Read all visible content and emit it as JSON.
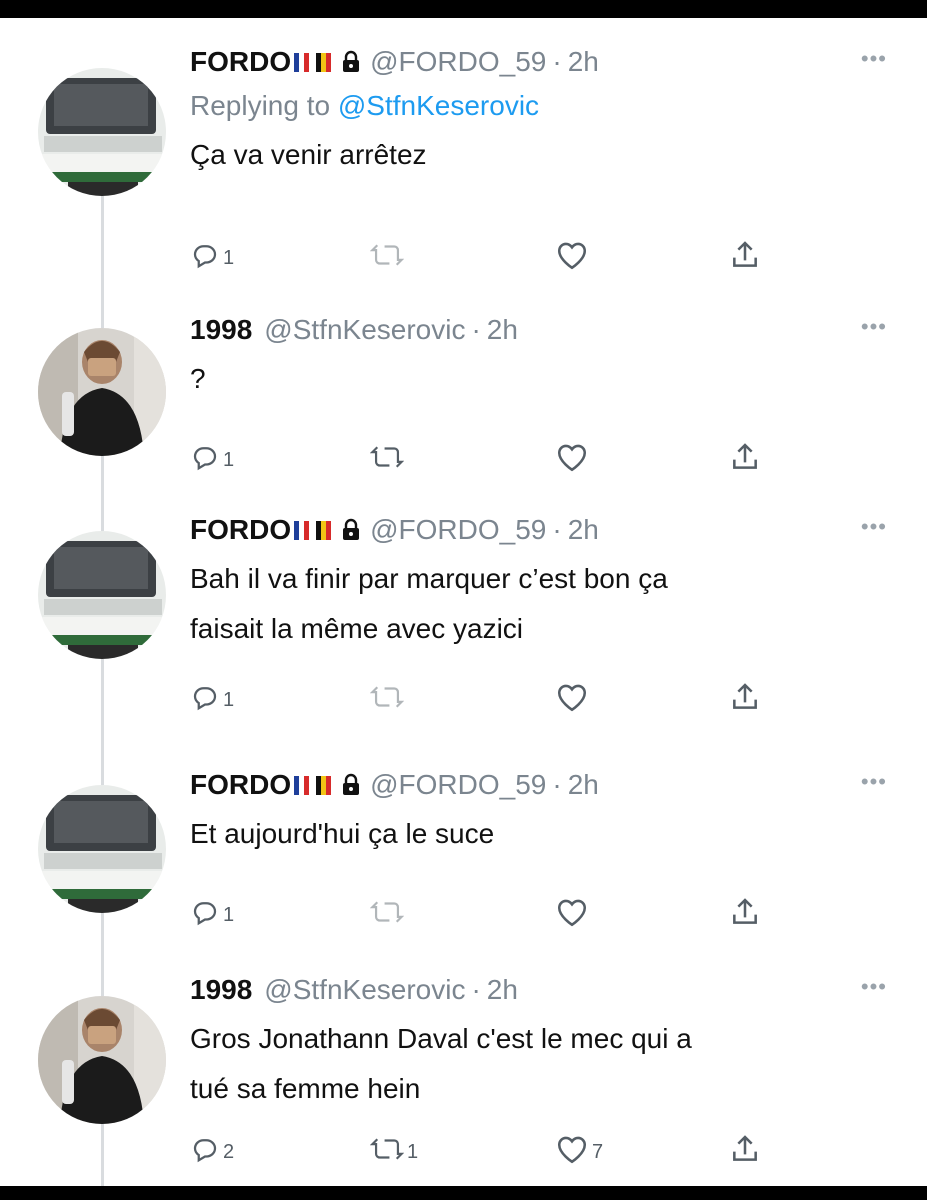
{
  "colors": {
    "link": "#1d9bf0",
    "muted": "#7b858f",
    "text": "#111111",
    "thread_line": "#d9dcdf"
  },
  "tweets": [
    {
      "avatar_icon": "monitor-photo-avatar",
      "name": "FORDO",
      "flags": [
        "flag-france-icon",
        "flag-belgium-icon"
      ],
      "locked": true,
      "handle": "@FORDO_59",
      "separator": "·",
      "time": "2h",
      "replying_label": "Replying to ",
      "replying_mention": "@StfnKeserovic",
      "text": [
        "Ça va venir arrêtez"
      ],
      "replies": "1",
      "retweets": "",
      "likes": "",
      "retweet_enabled": false
    },
    {
      "avatar_icon": "person-photo-avatar",
      "name": "1998",
      "flags": [],
      "locked": false,
      "handle": "@StfnKeserovic",
      "separator": "·",
      "time": "2h",
      "text": [
        "?"
      ],
      "replies": "1",
      "retweets": "",
      "likes": "",
      "retweet_enabled": true
    },
    {
      "avatar_icon": "monitor-photo-avatar",
      "name": "FORDO",
      "flags": [
        "flag-france-icon",
        "flag-belgium-icon"
      ],
      "locked": true,
      "handle": "@FORDO_59",
      "separator": "·",
      "time": "2h",
      "text": [
        "Bah il va finir par marquer c’est bon ça",
        "faisait la même avec yazici"
      ],
      "replies": "1",
      "retweets": "",
      "likes": "",
      "retweet_enabled": false
    },
    {
      "avatar_icon": "monitor-photo-avatar",
      "name": "FORDO",
      "flags": [
        "flag-france-icon",
        "flag-belgium-icon"
      ],
      "locked": true,
      "handle": "@FORDO_59",
      "separator": "·",
      "time": "2h",
      "text": [
        "Et aujourd'hui ça le suce"
      ],
      "replies": "1",
      "retweets": "",
      "likes": "",
      "retweet_enabled": false
    },
    {
      "avatar_icon": "person-photo-avatar",
      "name": "1998",
      "flags": [],
      "locked": false,
      "handle": "@StfnKeserovic",
      "separator": "·",
      "time": "2h",
      "text": [
        "Gros Jonathann Daval c'est le mec qui a",
        "tué sa femme hein"
      ],
      "replies": "2",
      "retweets": "1",
      "likes": "7",
      "retweet_enabled": true
    }
  ],
  "icons": {
    "more": "more-icon",
    "reply": "reply-icon",
    "retweet": "retweet-icon",
    "like": "like-icon",
    "share": "share-icon",
    "lock": "lock-icon"
  },
  "more_glyph": "•••"
}
